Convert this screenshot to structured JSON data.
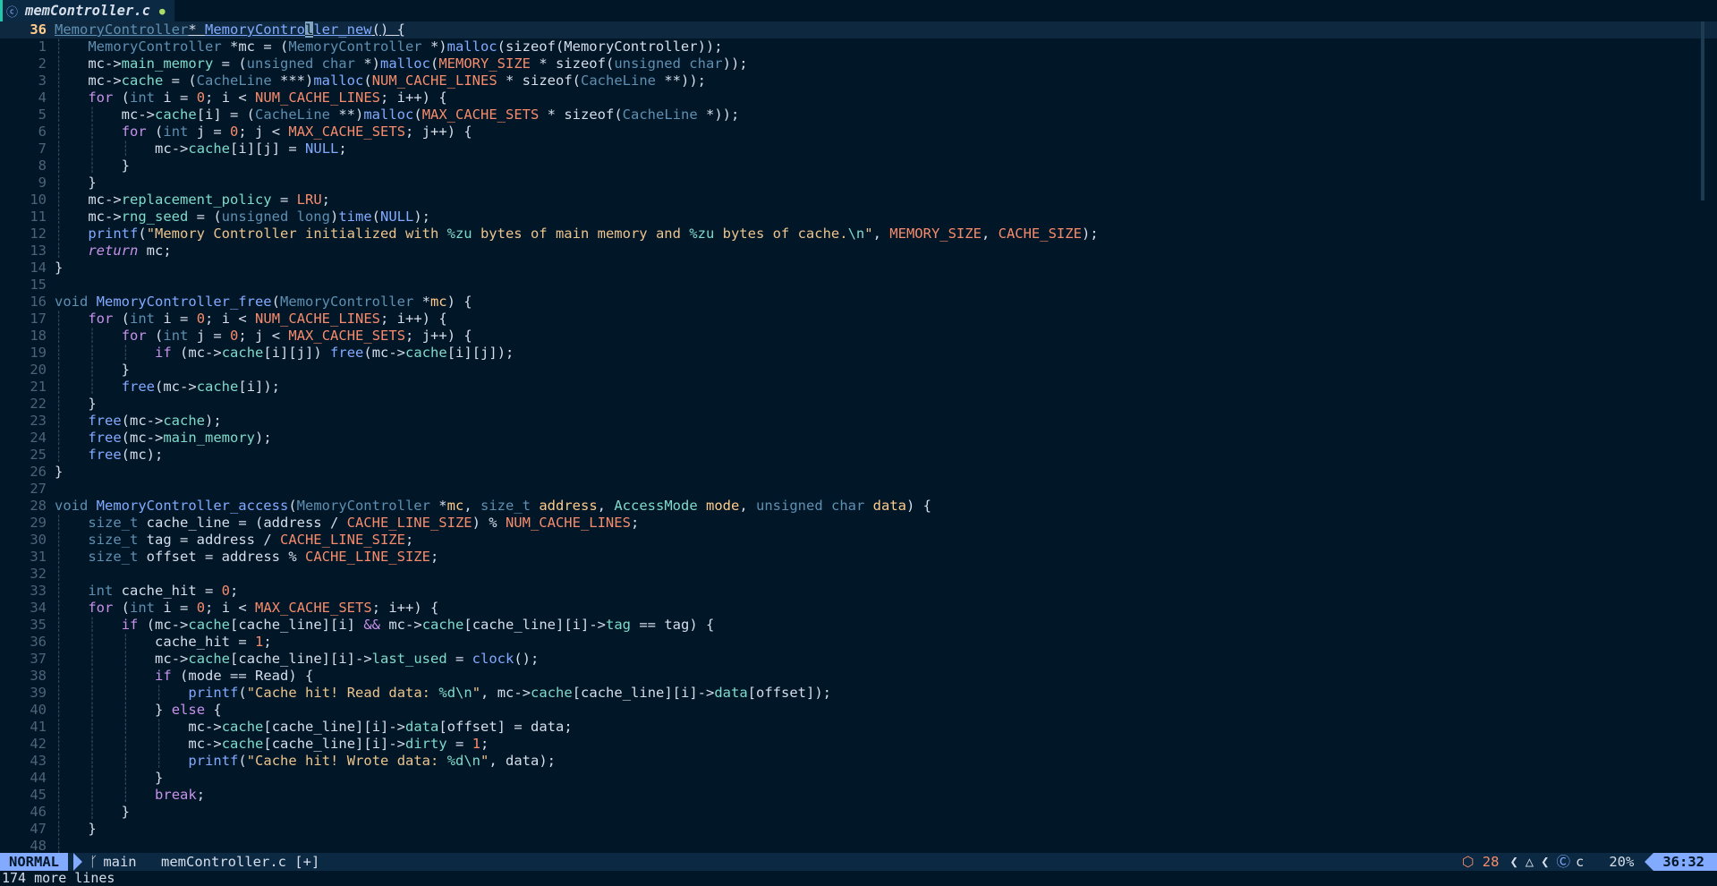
{
  "tab": {
    "icon": "c-file-icon",
    "filename": "memController.c",
    "modified_indicator": "●"
  },
  "editor": {
    "cursor_line": "36",
    "lines": [
      {
        "n": "36"
      },
      {
        "n": "1"
      },
      {
        "n": "2"
      },
      {
        "n": "3"
      },
      {
        "n": "4"
      },
      {
        "n": "5"
      },
      {
        "n": "6"
      },
      {
        "n": "7"
      },
      {
        "n": "8"
      },
      {
        "n": "9"
      },
      {
        "n": "10"
      },
      {
        "n": "11"
      },
      {
        "n": "12"
      },
      {
        "n": "13"
      },
      {
        "n": "14"
      },
      {
        "n": "15"
      },
      {
        "n": "16"
      },
      {
        "n": "17"
      },
      {
        "n": "18"
      },
      {
        "n": "19"
      },
      {
        "n": "20"
      },
      {
        "n": "21"
      },
      {
        "n": "22"
      },
      {
        "n": "23"
      },
      {
        "n": "24"
      },
      {
        "n": "25"
      },
      {
        "n": "26"
      },
      {
        "n": "27"
      },
      {
        "n": "28"
      },
      {
        "n": "29"
      },
      {
        "n": "30"
      },
      {
        "n": "31"
      },
      {
        "n": "32"
      },
      {
        "n": "33"
      },
      {
        "n": "34"
      },
      {
        "n": "35"
      },
      {
        "n": "36"
      },
      {
        "n": "37"
      },
      {
        "n": "38"
      },
      {
        "n": "39"
      },
      {
        "n": "40"
      },
      {
        "n": "41"
      },
      {
        "n": "42"
      },
      {
        "n": "43"
      },
      {
        "n": "44"
      },
      {
        "n": "45"
      },
      {
        "n": "46"
      },
      {
        "n": "47"
      },
      {
        "n": "48"
      }
    ]
  },
  "statusline": {
    "mode": "NORMAL",
    "branch_icon": "git-branch-icon",
    "branch": "main",
    "file": "memController.c [+]",
    "package_icon": "package-icon",
    "package_count": "28",
    "os_icon": "linux-icon",
    "lang_icon": "c-language-icon",
    "language": "c",
    "percent": "20%",
    "position": "36:32"
  },
  "cmdline": {
    "message": "174 more lines"
  },
  "colors": {
    "background": "#011627",
    "mode_bg": "#82aaff",
    "current_line_bg": "#0e293f",
    "string": "#ecc48d",
    "keyword": "#c792ea",
    "function": "#82aaff",
    "macro": "#f78c6c"
  }
}
